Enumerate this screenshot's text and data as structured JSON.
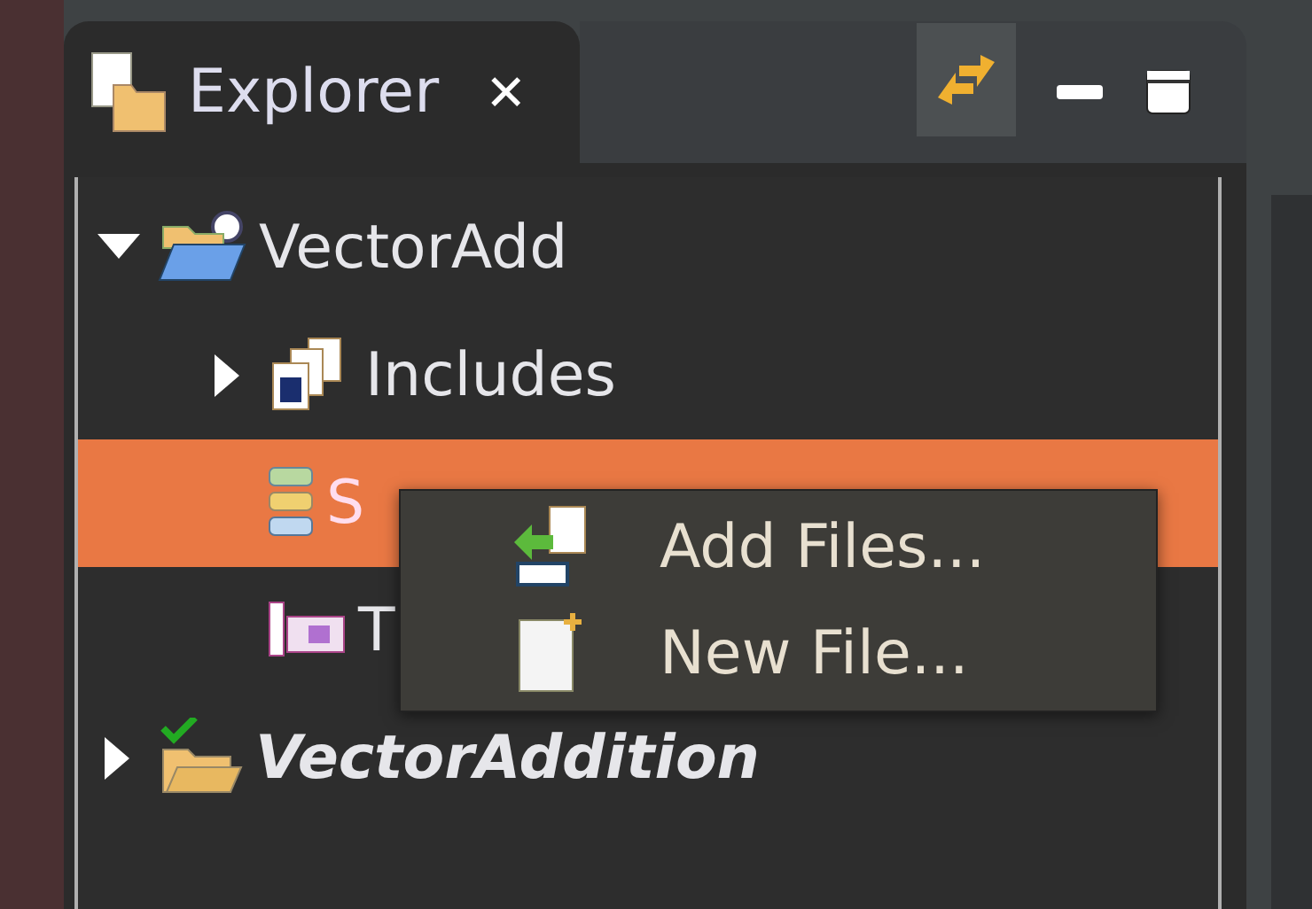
{
  "tab": {
    "label": "Explorer",
    "close": "✕",
    "selected": true
  },
  "tree": [
    {
      "label": "VectorAdd",
      "kind": "project",
      "expanded": true,
      "selected": false,
      "children": [
        {
          "label": "Includes",
          "kind": "includes",
          "expanded": false,
          "has_children": true,
          "selected": false
        },
        {
          "label": "S",
          "kind": "source",
          "selected": true
        },
        {
          "label": "T",
          "kind": "target",
          "selected": false
        }
      ]
    },
    {
      "label": "VectorAddition",
      "kind": "closed-project",
      "expanded": false,
      "has_children": true,
      "selected": false,
      "italic": true
    }
  ],
  "context_menu": [
    {
      "label": "Add Files...",
      "kind": "add-files"
    },
    {
      "label": "New File...",
      "kind": "new-file"
    }
  ]
}
